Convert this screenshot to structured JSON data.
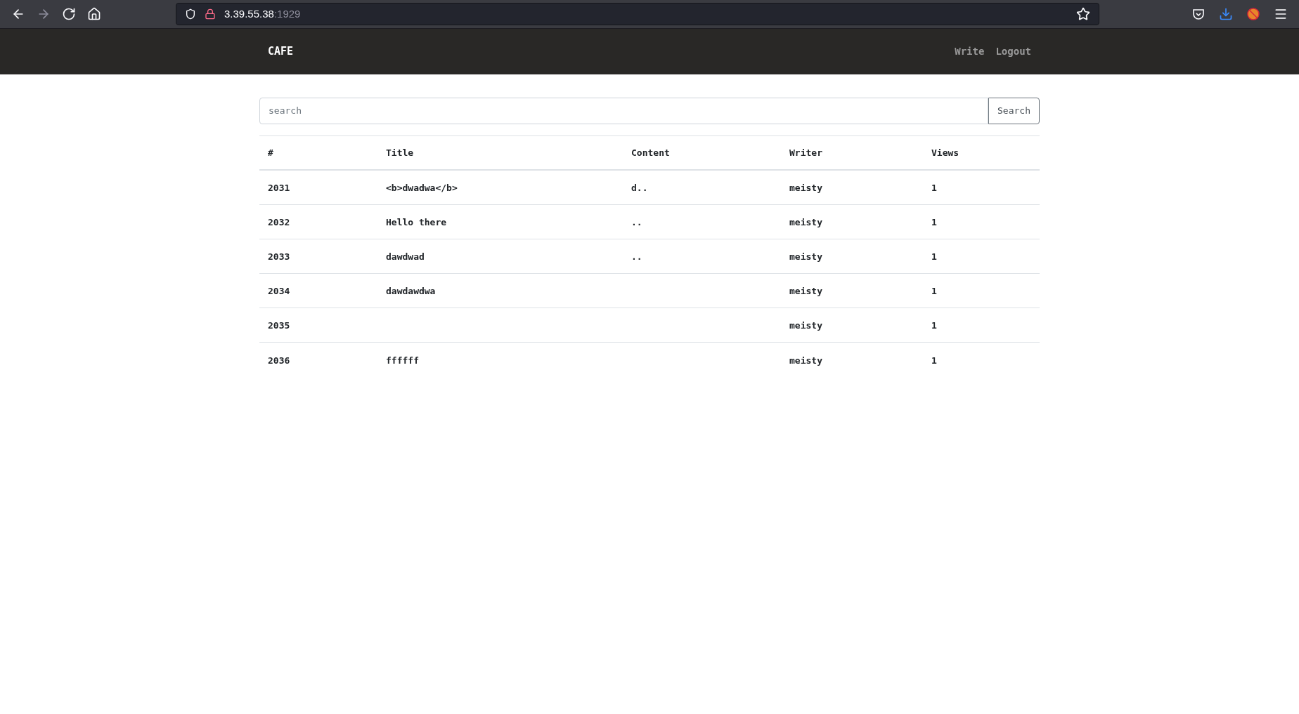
{
  "browser": {
    "url_host": "3.39.55.38",
    "url_port": ":1929"
  },
  "navbar": {
    "brand": "CAFE",
    "links": [
      "Write",
      "Logout"
    ]
  },
  "search": {
    "placeholder": "search",
    "button": "Search"
  },
  "table": {
    "columns": [
      "#",
      "Title",
      "Content",
      "Writer",
      "Views"
    ],
    "rows": [
      {
        "id": "2031",
        "title": "<b>dwadwa</b>",
        "content": "d..",
        "writer": "meisty",
        "views": "1"
      },
      {
        "id": "2032",
        "title": "Hello there",
        "content": "..",
        "writer": "meisty",
        "views": "1"
      },
      {
        "id": "2033",
        "title": "dawdwad",
        "content": "..",
        "writer": "meisty",
        "views": "1"
      },
      {
        "id": "2034",
        "title": "dawdawdwa",
        "writer": "meisty",
        "views": "1"
      },
      {
        "id": "2035",
        "writer": "meisty",
        "views": "1"
      },
      {
        "id": "2036",
        "title": "ffffff",
        "writer": "meisty",
        "views": "1"
      }
    ]
  }
}
